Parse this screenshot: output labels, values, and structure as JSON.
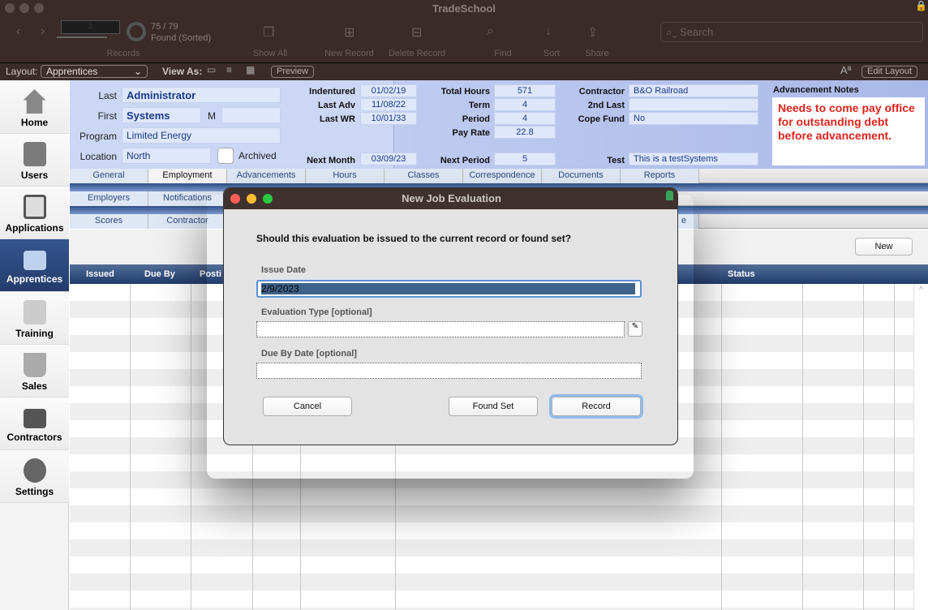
{
  "window": {
    "title": "TradeSchool"
  },
  "toolbar": {
    "record_number": "1",
    "found_count": "75 / 79",
    "found_status": "Found (Sorted)",
    "records_label": "Records",
    "show_all": "Show All",
    "new_record": "New Record",
    "delete_record": "Delete Record",
    "find": "Find",
    "sort": "Sort",
    "share": "Share",
    "search_placeholder": "Search"
  },
  "layoutbar": {
    "layout_label": "Layout:",
    "layout_value": "Apprentices",
    "view_as": "View As:",
    "preview": "Preview",
    "edit_layout": "Edit Layout",
    "font_icon_text": "Aª"
  },
  "sidebar": {
    "items": [
      {
        "label": "Home",
        "icon": "house-icon"
      },
      {
        "label": "Users",
        "icon": "address-book-icon"
      },
      {
        "label": "Applications",
        "icon": "clipboard-icon"
      },
      {
        "label": "Apprentices",
        "icon": "id-badge-icon",
        "selected": true
      },
      {
        "label": "Training",
        "icon": "certificate-icon"
      },
      {
        "label": "Sales",
        "icon": "basket-icon"
      },
      {
        "label": "Contractors",
        "icon": "briefcase-icon"
      },
      {
        "label": "Settings",
        "icon": "hammer-icon"
      }
    ]
  },
  "record": {
    "last_label": "Last",
    "last": "Administrator",
    "first_label": "First",
    "first": "Systems",
    "middle_label": "M",
    "middle": "",
    "program_label": "Program",
    "program": "Limited Energy",
    "location_label": "Location",
    "location": "North",
    "archived_label": "Archived",
    "indentured_label": "Indentured",
    "indentured": "01/02/19",
    "last_adv_label": "Last Adv",
    "last_adv": "11/08/22",
    "last_wr_label": "Last WR",
    "last_wr": "10/01/33",
    "next_month_label": "Next Month",
    "next_month": "03/09/23",
    "total_hours_label": "Total Hours",
    "total_hours": "571",
    "term_label": "Term",
    "term": "4",
    "period_label": "Period",
    "period": "4",
    "pay_rate_label": "Pay Rate",
    "pay_rate": "22.8",
    "next_period_label": "Next Period",
    "next_period": "5",
    "contractor_label": "Contractor",
    "contractor": "B&O Railroad",
    "second_last_label": "2nd Last",
    "second_last": "",
    "cope_fund_label": "Cope Fund",
    "cope_fund": "No",
    "test_label": "Test",
    "test": "This is a testSystems",
    "notes_label": "Advancement Notes",
    "notes": "Needs to come pay office for outstanding debt before advancement."
  },
  "tabs1": [
    "General",
    "Employment",
    "Advancements",
    "Hours",
    "Classes",
    "Correspondence",
    "Documents",
    "Reports"
  ],
  "tabs2": [
    "Employers",
    "Notifications"
  ],
  "tabs3": [
    "Scores",
    "Contractor"
  ],
  "tabs3_last_partial": "e",
  "work": {
    "new_button": "New"
  },
  "columns": {
    "issued": "Issued",
    "due_by": "Due By",
    "posting": "Posti",
    "status": "Status"
  },
  "dialog": {
    "title": "New Job Evaluation",
    "question": "Should this evaluation be issued to the current record or found set?",
    "issue_date_label": "Issue Date",
    "issue_date": "2/9/2023",
    "eval_type_label": "Evaluation Type [optional]",
    "eval_type": "",
    "due_by_label": "Due By Date [optional]",
    "due_by": "",
    "cancel": "Cancel",
    "found_set": "Found Set",
    "record": "Record"
  },
  "colors": {
    "sidebar_selected": "#2d4a7e",
    "notes_text": "#e0231c",
    "titlebar": "#3a2b28",
    "header_bar": "#1f3c6c"
  }
}
